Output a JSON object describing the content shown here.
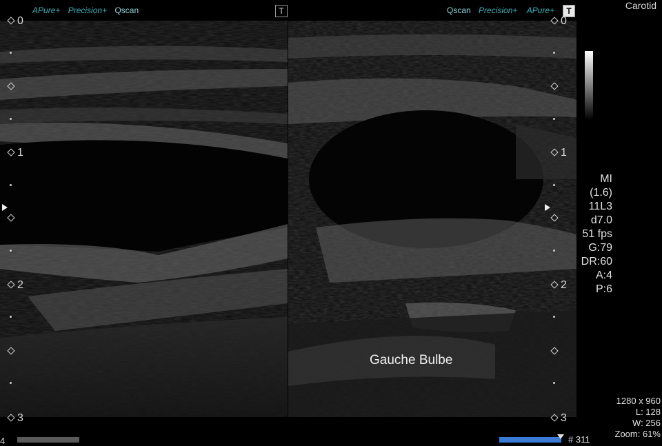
{
  "header": {
    "left_labels": [
      "Pure+",
      "Precision+",
      "Qscan"
    ],
    "right_labels": [
      "Qscan",
      "Precision+",
      "Pure+"
    ],
    "left_toggle_glyph": "T",
    "right_toggle_glyph": "T",
    "preset": "Carotid"
  },
  "depth_scale": {
    "marks": [
      "0",
      "1",
      "2",
      "3"
    ],
    "partial_left_label": "4"
  },
  "params": {
    "mi_label": "MI",
    "mi_value": "(1.6)",
    "probe": "11L3",
    "depth": "d7.0",
    "fps": "51 fps",
    "gain": "G:79",
    "dynamic_range": "DR:60",
    "a": "A:4",
    "p": "P:6"
  },
  "annotation": "Gauche Bulbe",
  "image_info": {
    "resolution": "1280 x 960",
    "level": "L: 128",
    "width": "W: 256",
    "zoom": "Zoom: 61%",
    "frame_partial": "# 311"
  },
  "colors": {
    "accent": "#35b1b8",
    "background": "#000000",
    "text": "#e6e6e6",
    "bottom_bar_right": "#3a7bd5"
  },
  "icons": [
    "t-toggle-icon",
    "focus-marker-icon",
    "grayscale-bar"
  ]
}
